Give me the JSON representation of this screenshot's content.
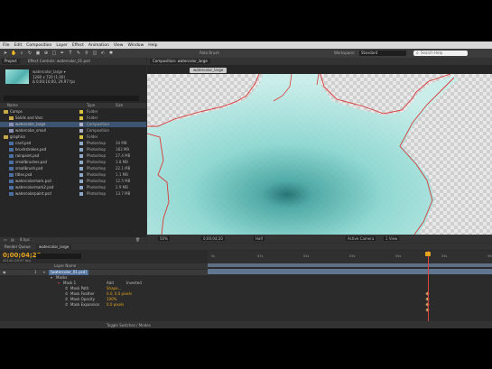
{
  "menu": [
    "File",
    "Edit",
    "Composition",
    "Layer",
    "Effect",
    "Animation",
    "View",
    "Window",
    "Help"
  ],
  "toolbar": {
    "tools_label": "Roto Brush",
    "workspace_label": "Workspace:",
    "workspace_value": "Standard",
    "search_placeholder": "Search Help"
  },
  "project": {
    "tabs": [
      "Project",
      "Effect Controls: watercolor_01.psd"
    ],
    "selected_name": "watercolor_large ▾",
    "info_line1": "1280 x 720 (1.00)",
    "info_line2": "Δ 0;00;10;00, 29.97 fps",
    "columns": {
      "name": "Name",
      "type": "Type",
      "size": "Size"
    },
    "items": [
      {
        "name": "Comps",
        "type": "Folder",
        "size": "",
        "indent": 0,
        "folder": true,
        "tag": "#d8c040"
      },
      {
        "name": "Solids and Vars",
        "type": "Folder",
        "size": "",
        "indent": 1,
        "folder": true,
        "tag": "#d8c040"
      },
      {
        "name": "watercolor_large",
        "type": "Composition",
        "size": "",
        "indent": 1,
        "folder": false,
        "tag": "#b0b0c8",
        "selected": true
      },
      {
        "name": "watercolor_small",
        "type": "Composition",
        "size": "",
        "indent": 1,
        "folder": false,
        "tag": "#b0b0c8"
      },
      {
        "name": "graphics",
        "type": "Folder",
        "size": "",
        "indent": 0,
        "folder": true,
        "tag": "#d8c040"
      },
      {
        "name": "card.psd",
        "type": "Photoshop",
        "size": "34 MB",
        "indent": 1,
        "folder": false,
        "tag": "#8fa8c8"
      },
      {
        "name": "brushstrokes.psd",
        "type": "Photoshop",
        "size": "183 MB",
        "indent": 1,
        "folder": false,
        "tag": "#8fa8c8"
      },
      {
        "name": "rainpaint.psd",
        "type": "Photoshop",
        "size": "27.4 MB",
        "indent": 1,
        "folder": false,
        "tag": "#8fa8c8"
      },
      {
        "name": "smallbrushes.psd",
        "type": "Photoshop",
        "size": "3.8 MB",
        "indent": 1,
        "folder": false,
        "tag": "#8fa8c8"
      },
      {
        "name": "smallbrush.psd",
        "type": "Photoshop",
        "size": "22.1 MB",
        "indent": 1,
        "folder": false,
        "tag": "#8fa8c8"
      },
      {
        "name": "titles.psd",
        "type": "Photoshop",
        "size": "1.1 MB",
        "indent": 1,
        "folder": false,
        "tag": "#8fa8c8"
      },
      {
        "name": "watercolormark.psd",
        "type": "Photoshop",
        "size": "12.5 MB",
        "indent": 1,
        "folder": false,
        "tag": "#8fa8c8"
      },
      {
        "name": "watercolormark2.psd",
        "type": "Photoshop",
        "size": "2.9 MB",
        "indent": 1,
        "folder": false,
        "tag": "#8fa8c8"
      },
      {
        "name": "watercolorpaint.psd",
        "type": "Photoshop",
        "size": "13.7 MB",
        "indent": 1,
        "folder": false,
        "tag": "#8fa8c8"
      }
    ],
    "bottom_info": "8 bpc"
  },
  "composition": {
    "tab": "Composition: watercolor_large",
    "subtab": "watercolor_large",
    "bottom": {
      "zoom": "50%",
      "time": "0;00;04;20",
      "res": "Half",
      "camera": "Active Camera",
      "views": "1 View"
    }
  },
  "timeline": {
    "tabs": [
      "Render Queue",
      "watercolor_large"
    ],
    "timecode": "0;00;04;20",
    "fps": "00140 (29.97 fps)",
    "layer_header": "Layer Name",
    "ruler_ticks": [
      "0s",
      "01s",
      "02s",
      "03s",
      "04s",
      "05s",
      "06s"
    ],
    "rows": [
      {
        "label": "1",
        "name": "[watercolor_01.psd]",
        "indent": 10,
        "type": "layer"
      },
      {
        "label": "",
        "name": "Masks",
        "indent": 18,
        "type": "group"
      },
      {
        "label": "",
        "name": "Mask 1",
        "indent": 26,
        "type": "mask",
        "mode": "Add",
        "extra": "Inverted"
      },
      {
        "label": "",
        "name": "Mask Path",
        "indent": 34,
        "type": "prop",
        "value": "Shape..."
      },
      {
        "label": "",
        "name": "Mask Feather",
        "indent": 34,
        "type": "prop",
        "value": "0.0, 0.0 pixels"
      },
      {
        "label": "",
        "name": "Mask Opacity",
        "indent": 34,
        "type": "prop",
        "value": "100%"
      },
      {
        "label": "",
        "name": "Mask Expansion",
        "indent": 34,
        "type": "prop",
        "value": "0.0 pixels"
      }
    ],
    "footer": "Toggle Switches / Modes"
  }
}
